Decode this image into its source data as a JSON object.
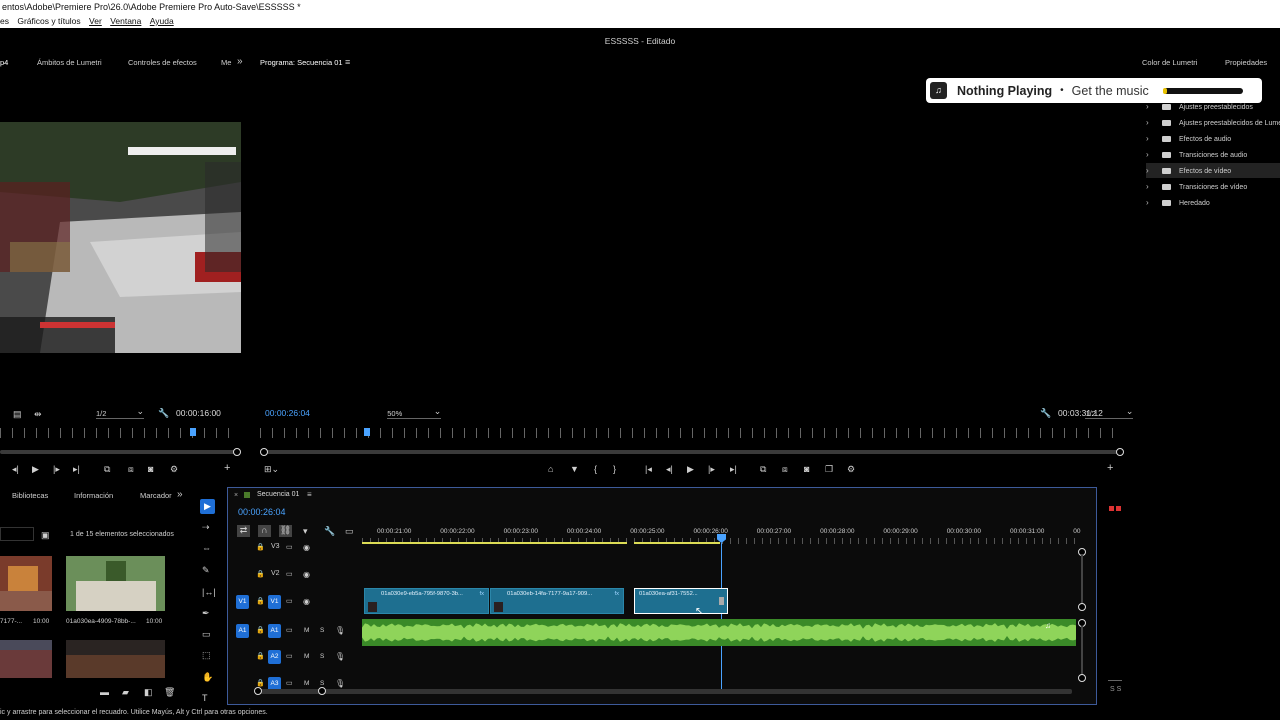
{
  "window": {
    "title": "entos\\Adobe\\Premiere Pro\\26.0\\Adobe Premiere Pro Auto-Save\\ESSSSS *",
    "menu": [
      "es",
      "Gráficos y títulos",
      "Ver",
      "Ventana",
      "Ayuda"
    ],
    "project_title": "ESSSSS - Editado"
  },
  "top_tabs": {
    "left": [
      "p4",
      "Ámbitos de Lumetri",
      "Controles de efectos",
      "Me",
      "»",
      "Programa: Secuencia 01",
      "≡"
    ],
    "right": [
      "Color de Lumetri",
      "Propiedades"
    ]
  },
  "music_widget": {
    "status": "Nothing Playing",
    "separator": "•",
    "cta": "Get the music",
    "progress": 0.05,
    "accent": "#e8c200"
  },
  "effects_tree": {
    "items": [
      {
        "label": "Ajustes preestablecidos",
        "selected": false
      },
      {
        "label": "Ajustes preestablecidos de Lumetri",
        "selected": false
      },
      {
        "label": "Efectos de audio",
        "selected": false
      },
      {
        "label": "Transiciones de audio",
        "selected": false
      },
      {
        "label": "Efectos de vídeo",
        "selected": true
      },
      {
        "label": "Transiciones de vídeo",
        "selected": false
      },
      {
        "label": "Heredado",
        "selected": false
      }
    ]
  },
  "source_monitor": {
    "resolution": "1/2",
    "timecode": "00:00:16:00"
  },
  "program_monitor": {
    "timecode": "00:00:26:04",
    "zoom": "50%",
    "resolution": "1/2",
    "duration": "00:03:31:12"
  },
  "project_panel": {
    "tabs": [
      "Bibliotecas",
      "Información",
      "Marcador",
      "»"
    ],
    "selection_info": "1 de 15 elementos seleccionados",
    "items": [
      {
        "name": "7177-...",
        "duration": "10:00"
      },
      {
        "name": "01a030ea-4909-78bb-...",
        "duration": "10:00"
      }
    ]
  },
  "timeline": {
    "sequence_name": "Secuencia 01",
    "current_time": "00:00:26:04",
    "ruler": [
      "00:00:21:00",
      "00:00:22:00",
      "00:00:23:00",
      "00:00:24:00",
      "00:00:25:00",
      "00:00:26:00",
      "00:00:27:00",
      "00:00:28:00",
      "00:00:29:00",
      "00:00:30:00",
      "00:00:31:00",
      "00"
    ],
    "tracks": [
      {
        "id": "V3",
        "type": "video"
      },
      {
        "id": "V2",
        "type": "video"
      },
      {
        "id": "V1",
        "type": "video",
        "source": "V1"
      },
      {
        "id": "A1",
        "type": "audio",
        "source": "A1",
        "m": "M",
        "s": "S"
      },
      {
        "id": "A2",
        "type": "audio",
        "m": "M",
        "s": "S"
      },
      {
        "id": "A3",
        "type": "audio",
        "m": "M",
        "s": "S"
      }
    ],
    "clips": [
      {
        "name": "01a030e9-eb5a-795f-9870-3b...",
        "fx": "fx"
      },
      {
        "name": "01a030eb-14fa-7177-9a17-909...",
        "fx": "fx"
      },
      {
        "name": "01a030ea-af31-7552...",
        "fx": "fx"
      }
    ]
  },
  "status_bar": {
    "hint": "ic y arrastre para seleccionar el recuadro. Utilice Mayús, Alt y Ctrl para otras opciones.",
    "right": "S S"
  },
  "colors": {
    "accent_blue": "#1f6fd6",
    "clip_blue": "#1e6f90",
    "audio_green": "#3a8a28",
    "timecode_blue": "#4aa3ff"
  }
}
